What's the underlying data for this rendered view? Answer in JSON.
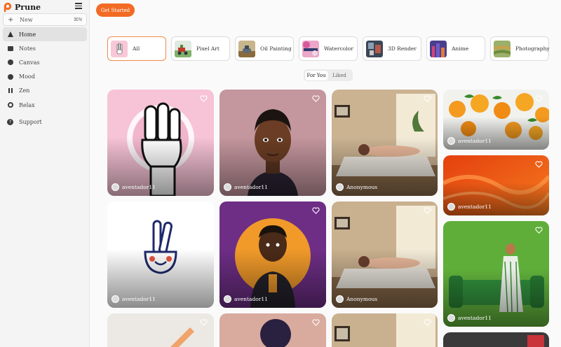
{
  "app": {
    "name": "Prune"
  },
  "sidebar": {
    "new_label": "New",
    "new_shortcut": "⌘N",
    "items": [
      {
        "label": "Home",
        "icon": "home-icon",
        "active": true
      },
      {
        "label": "Notes",
        "icon": "notes-icon"
      },
      {
        "label": "Canvas",
        "icon": "canvas-icon"
      },
      {
        "label": "Mood",
        "icon": "mood-icon"
      },
      {
        "label": "Zen",
        "icon": "zen-icon"
      },
      {
        "label": "Relax",
        "icon": "relax-icon"
      }
    ],
    "support_label": "Support"
  },
  "header": {
    "cta_label": "Get Started",
    "accent": "#f26b24"
  },
  "categories": [
    {
      "label": "All",
      "selected": true
    },
    {
      "label": "Pixel Art"
    },
    {
      "label": "Oil Painting"
    },
    {
      "label": "Watercolor"
    },
    {
      "label": "3D Render"
    },
    {
      "label": "Anime"
    },
    {
      "label": "Photography"
    }
  ],
  "feed_toggle": {
    "for_you": "For You",
    "liked": "Liked",
    "selected": "For You"
  },
  "gallery": [
    {
      "author": "aventador11",
      "subject": "three-finger hand sign on pink"
    },
    {
      "author": "aventador11",
      "subject": "cartoon boy portrait on mauve"
    },
    {
      "author": "Anonymous",
      "subject": "spa massage room"
    },
    {
      "author": "aventador11",
      "subject": "oranges with leaves"
    },
    {
      "author": "aventador11",
      "subject": "orange abstract waves"
    },
    {
      "author": "aventador11",
      "subject": "peace sign hand emoji"
    },
    {
      "author": "aventador11",
      "subject": "cartoon boy on orange circle"
    },
    {
      "author": "Anonymous",
      "subject": "spa massage room"
    },
    {
      "author": "aventador11",
      "subject": "woman on green sofa"
    }
  ]
}
